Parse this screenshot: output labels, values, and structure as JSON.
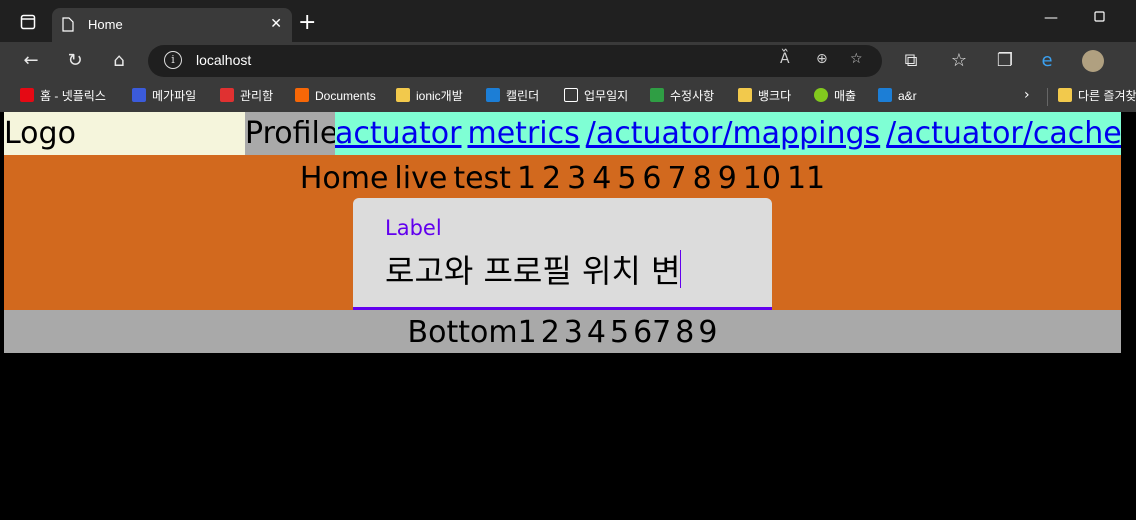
{
  "browser": {
    "tab_title": "Home",
    "url": "localhost",
    "bookmarks": [
      {
        "label": "홈 - 넷플릭스",
        "color": "#e50914"
      },
      {
        "label": "메가파일",
        "color": "#3b5bdb"
      },
      {
        "label": "관리함",
        "color": "#e03131"
      },
      {
        "label": "Documents",
        "color": "#f76707"
      },
      {
        "label": "ionic개발",
        "color": "#f2c94c"
      },
      {
        "label": "캘린더",
        "color": "#1c7ed6"
      },
      {
        "label": "업무일지",
        "color": "#ffffff"
      },
      {
        "label": "수정사항",
        "color": "#2f9e44"
      },
      {
        "label": "뱅크다",
        "color": "#f2c94c"
      },
      {
        "label": "매출",
        "color": "#82c91e"
      },
      {
        "label": "a&r",
        "color": "#1c7ed6"
      },
      {
        "label": "다른 즐겨찾",
        "color": "#f2c94c"
      }
    ]
  },
  "header": {
    "logo": "Logo",
    "profile": "Profile",
    "links": [
      "actuator",
      "metrics",
      "/actuator/mappings",
      "/actuator/caches"
    ]
  },
  "nav": {
    "items": [
      "Home",
      "live",
      "test",
      "1",
      "2",
      "3",
      "4",
      "5",
      "6",
      "7",
      "8",
      "9",
      "10",
      "11"
    ]
  },
  "input": {
    "label": "Label",
    "value": "로고와 프로필 위치 변"
  },
  "footer": {
    "items": [
      "Bottom1",
      "2",
      "3",
      "4",
      "5",
      "67",
      "8",
      "9"
    ]
  },
  "colors": {
    "logo_bg": "#f5f5dc",
    "profile_bg": "#a9a9a9",
    "links_bg": "#7fffd4",
    "middle_bg": "#d2691e",
    "accent": "#6200ee"
  }
}
